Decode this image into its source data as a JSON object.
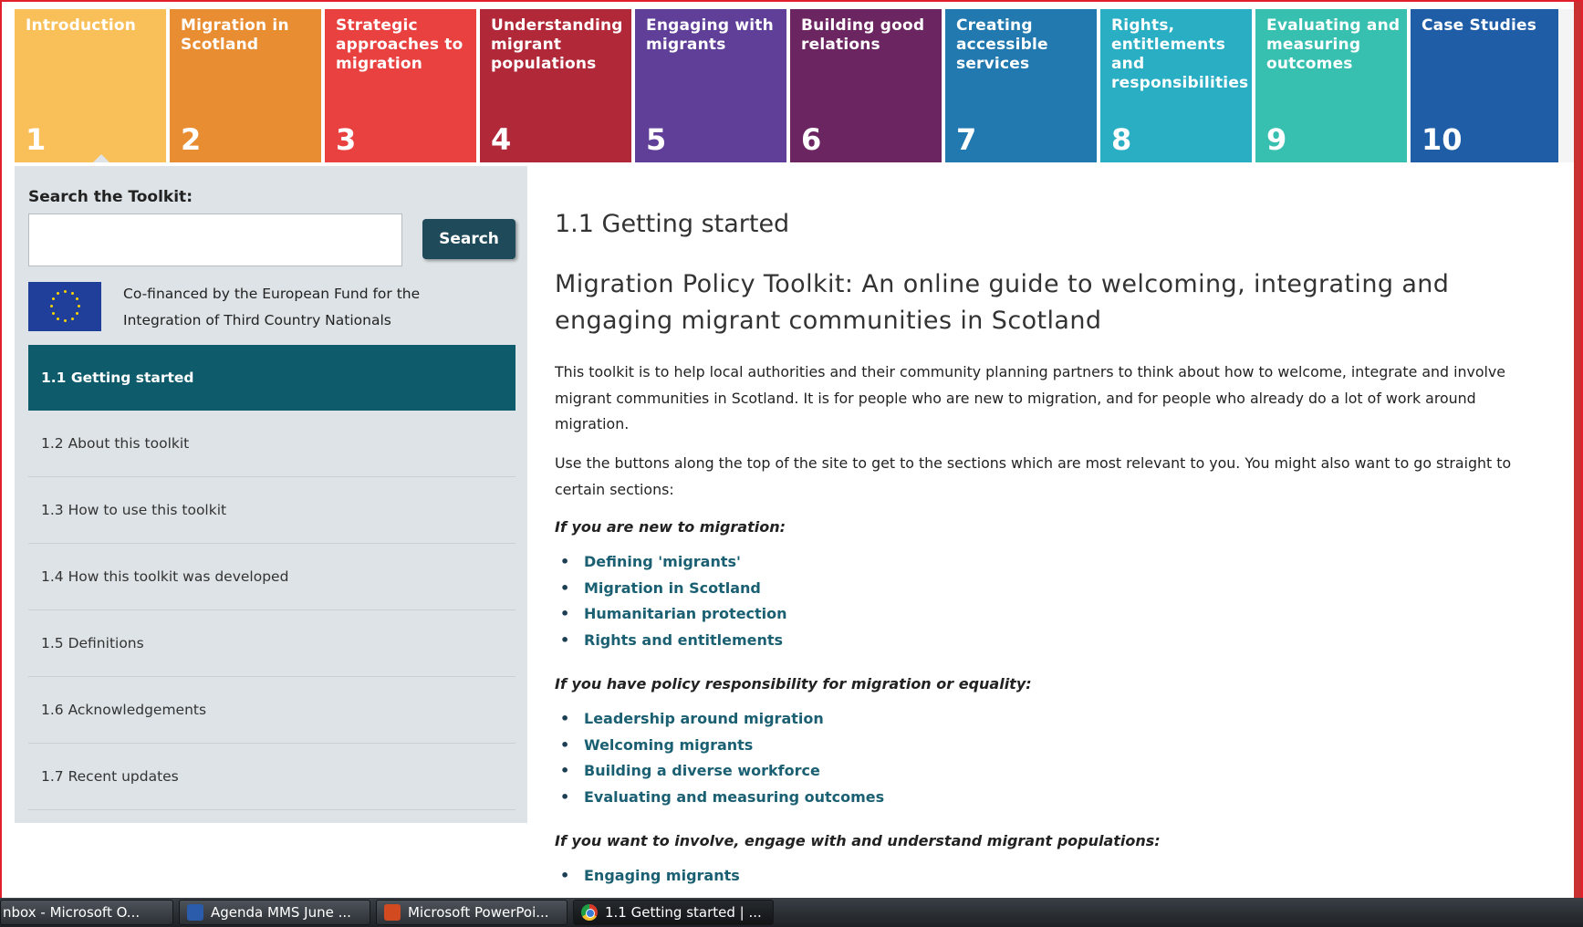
{
  "nav": {
    "tabs": [
      {
        "label": "Introduction",
        "number": "1",
        "color": "#f9c05a",
        "active": true
      },
      {
        "label": "Migration in Scotland",
        "number": "2",
        "color": "#e98d32"
      },
      {
        "label": "Strategic approaches to migration",
        "number": "3",
        "color": "#e94040"
      },
      {
        "label": "Understanding migrant populations",
        "number": "4",
        "color": "#b12938"
      },
      {
        "label": "Engaging with migrants",
        "number": "5",
        "color": "#5f3f97"
      },
      {
        "label": "Building good relations",
        "number": "6",
        "color": "#6b2560"
      },
      {
        "label": "Creating accessible services",
        "number": "7",
        "color": "#2279b0"
      },
      {
        "label": "Rights, entitlements and responsibilities",
        "number": "8",
        "color": "#2aaec3"
      },
      {
        "label": "Evaluating and measuring outcomes",
        "number": "9",
        "color": "#37c0b0"
      },
      {
        "label": "Case Studies",
        "number": "10",
        "color": "#1f5ea6"
      }
    ]
  },
  "sidebar": {
    "search_label": "Search the Toolkit:",
    "search_value": "",
    "search_button": "Search",
    "eu_line1": "Co-financed by the European Fund for the",
    "eu_line2": "Integration of Third Country Nationals",
    "items": [
      {
        "label": "1.1 Getting started",
        "active": true
      },
      {
        "label": "1.2 About this toolkit"
      },
      {
        "label": "1.3 How to use this toolkit"
      },
      {
        "label": "1.4 How this toolkit was developed"
      },
      {
        "label": "1.5 Definitions"
      },
      {
        "label": "1.6 Acknowledgements"
      },
      {
        "label": "1.7 Recent updates"
      }
    ]
  },
  "content": {
    "heading": "1.1 Getting started",
    "subheading": "Migration Policy Toolkit: An online guide to welcoming, integrating and engaging migrant communities in Scotland",
    "para1": "This toolkit is to help local authorities and their community planning partners to think about how to welcome, integrate and involve migrant communities in Scotland.  It is for people who are new to migration, and for people who already do a lot of work around migration.",
    "para2": "Use the buttons along the top of the site to get to the sections which are most relevant to you.  You might also want to go straight to certain sections:",
    "sections": [
      {
        "title": "If you are new to migration:",
        "links": [
          "Defining 'migrants'",
          "Migration in Scotland",
          "Humanitarian protection",
          "Rights and entitlements"
        ]
      },
      {
        "title": "If you have policy responsibility for migration or equality:",
        "links": [
          "Leadership around migration",
          "Welcoming migrants",
          "Building a diverse workforce",
          "Evaluating and measuring outcomes"
        ]
      },
      {
        "title": "If you want to involve, engage with and understand migrant populations:",
        "links": [
          "Engaging migrants"
        ]
      }
    ]
  },
  "taskbar": {
    "tasks": [
      {
        "label": "nbox - Microsoft O...",
        "icon": "outlook-icon"
      },
      {
        "label": "Agenda  MMS June ...",
        "icon": "word-icon"
      },
      {
        "label": "Microsoft PowerPoi...",
        "icon": "powerpoint-icon"
      },
      {
        "label": "1.1 Getting started | ...",
        "icon": "chrome-icon",
        "active": true
      }
    ]
  }
}
